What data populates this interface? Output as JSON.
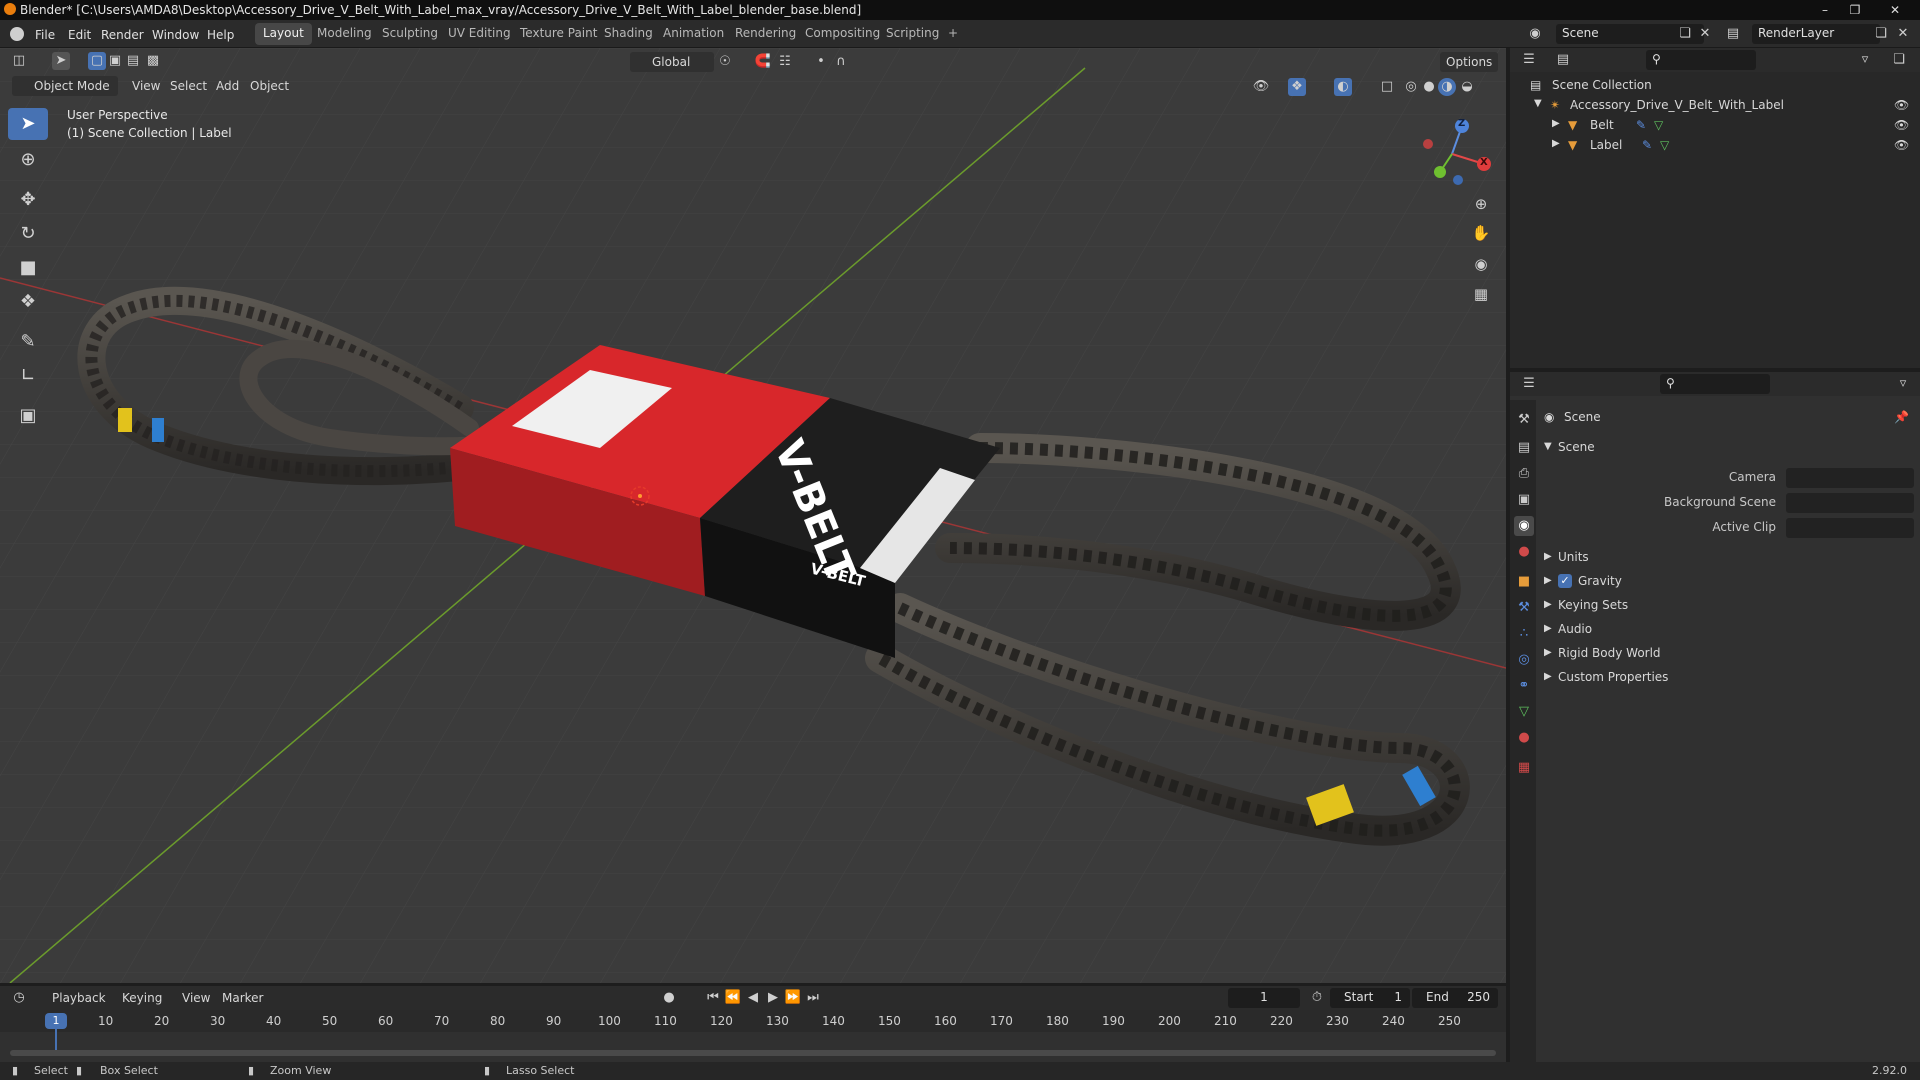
{
  "window": {
    "title": "Blender* [C:\\Users\\AMDA8\\Desktop\\Accessory_Drive_V_Belt_With_Label_max_vray/Accessory_Drive_V_Belt_With_Label_blender_base.blend]"
  },
  "menu": [
    "File",
    "Edit",
    "Render",
    "Window",
    "Help"
  ],
  "workspaces": [
    "Layout",
    "Modeling",
    "Sculpting",
    "UV Editing",
    "Texture Paint",
    "Shading",
    "Animation",
    "Rendering",
    "Compositing",
    "Scripting"
  ],
  "active_workspace": "Layout",
  "add_workspace": "+",
  "scene_field": "Scene",
  "renderlayer_field": "RenderLayer",
  "viewport_header": {
    "mode": "Object Mode",
    "menus": [
      "View",
      "Select",
      "Add",
      "Object"
    ],
    "transform_orientation": "Global",
    "options": "Options"
  },
  "viewport": {
    "view_name": "User Perspective",
    "collection_info": "(1) Scene Collection | Label",
    "gizmo": {
      "z": "Z",
      "y": "Y",
      "x": "X"
    },
    "belt_box_text": "V-BELT",
    "belt_box_text_small": "V-BELT"
  },
  "outliner": {
    "root": "Scene Collection",
    "collection": "Accessory_Drive_V_Belt_With_Label",
    "objects": [
      "Belt",
      "Label"
    ]
  },
  "properties": {
    "header": "Scene",
    "panel_title": "Scene",
    "fields": [
      {
        "label": "Camera",
        "value": ""
      },
      {
        "label": "Background Scene",
        "value": ""
      },
      {
        "label": "Active Clip",
        "value": ""
      }
    ],
    "subpanels": [
      "Units",
      "Gravity",
      "Keying Sets",
      "Audio",
      "Rigid Body World",
      "Custom Properties"
    ],
    "gravity_checked": true
  },
  "timeline": {
    "menus": [
      "Playback",
      "Keying",
      "View",
      "Marker"
    ],
    "current_frame": "1",
    "start_label": "Start",
    "start": "1",
    "end_label": "End",
    "end": "250",
    "ticks": [
      "10",
      "20",
      "30",
      "40",
      "50",
      "60",
      "70",
      "80",
      "90",
      "100",
      "110",
      "120",
      "130",
      "140",
      "150",
      "160",
      "170",
      "180",
      "190",
      "200",
      "210",
      "220",
      "230",
      "240",
      "250"
    ],
    "playhead": "1"
  },
  "statusbar": {
    "items": [
      "Select",
      "Box Select",
      "Zoom View",
      "Lasso Select"
    ],
    "version": "2.92.0"
  },
  "colors": {
    "accent": "#4772b3",
    "box_red": "#d8272b",
    "box_black": "#1e1e1e",
    "grid_bg": "#3b3b3b",
    "axis_red": "#a33838",
    "axis_green": "#6a9a2a"
  }
}
